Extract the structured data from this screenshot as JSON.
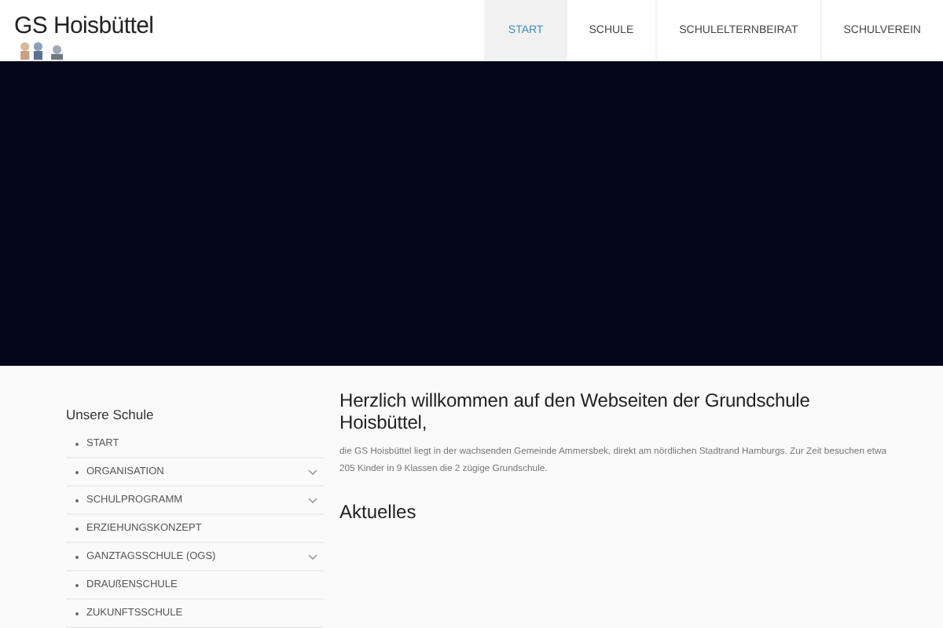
{
  "site_title": "GS Hoisbüttel",
  "nav": [
    {
      "label": "START",
      "selected": true
    },
    {
      "label": "SCHULE",
      "selected": false
    },
    {
      "label": "SCHULELTERNBEIRAT",
      "selected": false
    },
    {
      "label": "SCHULVEREIN",
      "selected": false
    }
  ],
  "sidebar": {
    "title": "Unsere Schule",
    "items": [
      {
        "label": "START",
        "has_submenu": false
      },
      {
        "label": "ORGANISATION",
        "has_submenu": true
      },
      {
        "label": "SCHULPROGRAMM",
        "has_submenu": true
      },
      {
        "label": "ERZIEHUNGSKONZEPT",
        "has_submenu": false
      },
      {
        "label": "GANZTAGSSCHULE (OGS)",
        "has_submenu": true
      },
      {
        "label": "DRAUßENSCHULE",
        "has_submenu": false
      },
      {
        "label": "ZUKUNFTSSCHULE",
        "has_submenu": false
      }
    ]
  },
  "content": {
    "heading": "Herzlich willkommen auf den Webseiten der Grundschule Hoisbüttel,",
    "intro": "die GS Hoisbüttel liegt in der wachsenden Gemeinde Ammersbek, direkt am nördlichen Stadtrand Hamburgs. Zur Zeit besuchen etwa 205 Kinder in 9 Klassen die 2 zügige Grundschule.",
    "section_heading": "Aktuelles"
  }
}
